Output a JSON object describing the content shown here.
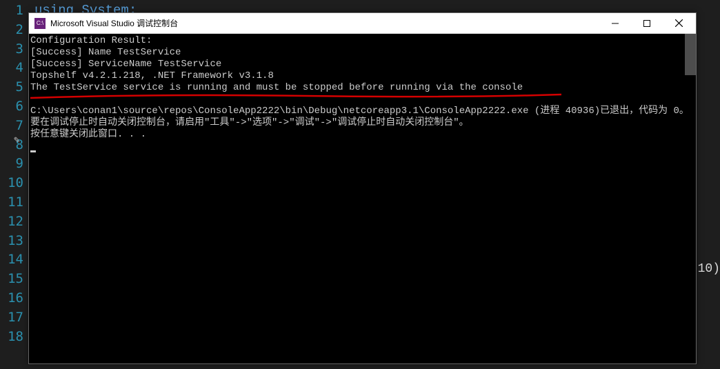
{
  "gutter_lines": [
    "1",
    "2",
    "3",
    "4",
    "5",
    "6",
    "7",
    "8",
    "9",
    "10",
    "11",
    "12",
    "13",
    "14",
    "15",
    "16",
    "17",
    "18"
  ],
  "editor": {
    "visible_text_fragment": "using System;",
    "right_fragment": "10)"
  },
  "window": {
    "app_icon_text": "C:\\",
    "title": "Microsoft Visual Studio 调试控制台"
  },
  "console": {
    "lines": [
      "Configuration Result:",
      "[Success] Name TestService",
      "[Success] ServiceName TestService",
      "Topshelf v4.2.1.218, .NET Framework v3.1.8",
      "The TestService service is running and must be stopped before running via the console",
      "",
      "C:\\Users\\conan1\\source\\repos\\ConsoleApp2222\\bin\\Debug\\netcoreapp3.1\\ConsoleApp2222.exe (进程 40936)已退出，代码为 0。",
      "要在调试停止时自动关闭控制台，请启用\"工具\"->\"选项\"->\"调试\"->\"调试停止时自动关闭控制台\"。",
      "按任意键关闭此窗口. . ."
    ]
  }
}
